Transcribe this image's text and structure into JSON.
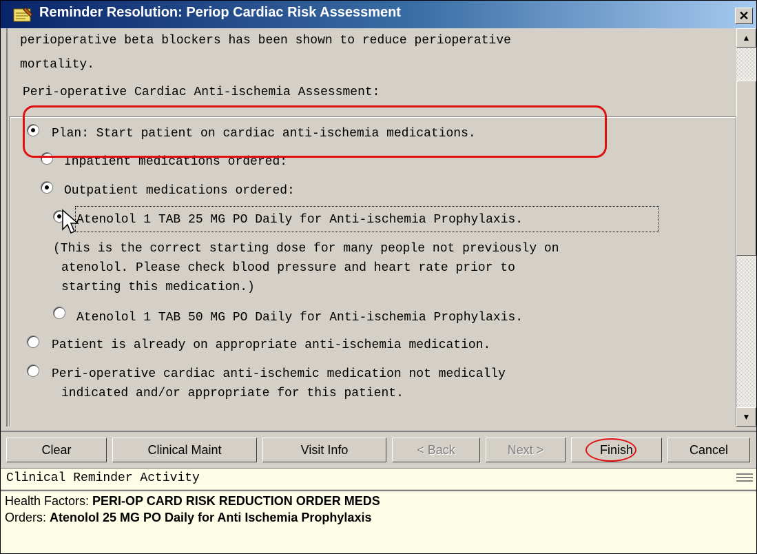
{
  "window": {
    "title": "Reminder Resolution: Periop Cardiac Risk Assessment",
    "close_glyph": "✕"
  },
  "content": {
    "intro_line1": "perioperative beta blockers has been shown to reduce perioperative",
    "intro_line2": "mortality.",
    "section_title": "Peri-operative Cardiac Anti-ischemia Assessment:",
    "plan_label": "Plan: Start patient on cardiac anti-ischemia medications.",
    "inpatient_label": "Inpatient medications ordered:",
    "outpatient_label": "Outpatient medications ordered:",
    "atenolol25_label": "Atenolol 1 TAB 25 MG PO Daily for Anti-ischemia Prophylaxis.",
    "note_line1": "(This is the correct starting dose for many people not previously on",
    "note_line2": "atenolol. Please check blood pressure and heart rate prior to",
    "note_line3": "starting this medication.)",
    "atenolol50_label": "Atenolol 1 TAB 50 MG PO Daily for Anti-ischemia Prophylaxis.",
    "already_on_label": "Patient is already on appropriate anti-ischemia medication.",
    "not_indicated_line1": "Peri-operative cardiac anti-ischemic medication not medically",
    "not_indicated_line2": "indicated and/or appropriate for this patient."
  },
  "buttons": {
    "clear": "Clear",
    "clinical_maint": "Clinical Maint",
    "visit_info": "Visit Info",
    "back": "< Back",
    "next": "Next >",
    "finish": "Finish",
    "cancel": "Cancel"
  },
  "activity_header": "Clinical Reminder Activity",
  "activity": {
    "health_factors_label": "Health Factors: ",
    "health_factors_value": "PERI-OP CARD RISK REDUCTION ORDER MEDS",
    "orders_label": "Orders: ",
    "orders_value": "Atenolol 25 MG PO Daily for Anti Ischemia Prophylaxis"
  },
  "colors": {
    "title_bar": "#0a246a",
    "highlight": "#e01010",
    "panel": "#d4d0c8",
    "activity_bg": "#fdfde8"
  }
}
